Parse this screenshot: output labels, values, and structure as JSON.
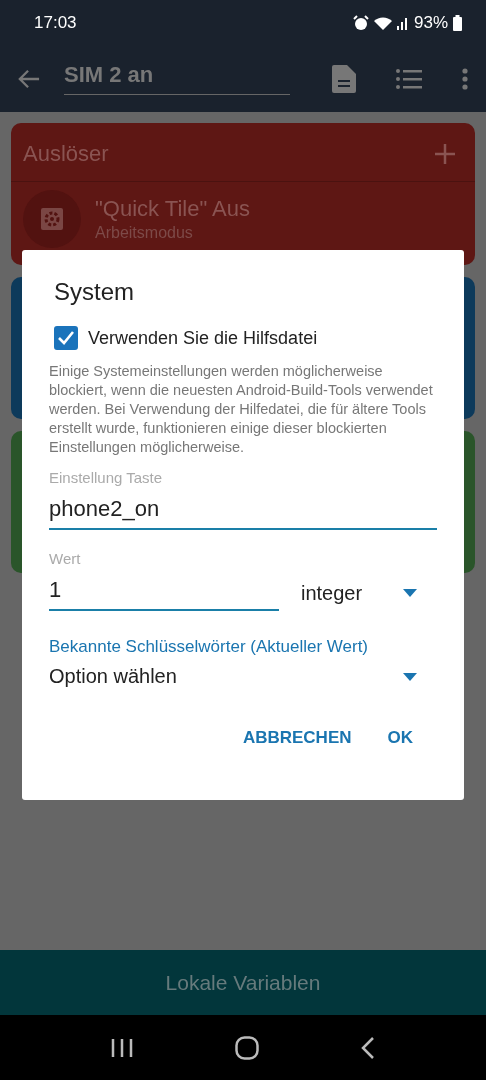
{
  "status_bar": {
    "time": "17:03",
    "battery": "93%"
  },
  "app_bar": {
    "title": "SIM 2 an"
  },
  "sections": [
    {
      "title": "Auslöser",
      "color": "#5e1714",
      "items": [
        {
          "title": "\"Quick Tile\" Aus",
          "subtitle": "Arbeitsmodus"
        }
      ]
    },
    {
      "color": "#0d3a5b"
    },
    {
      "color": "#2a552a"
    }
  ],
  "dialog": {
    "title": "System",
    "checkbox": {
      "label": "Verwenden Sie die Hilfsdatei",
      "checked": true
    },
    "description": "Einige Systemeinstellungen werden möglicherweise blockiert, wenn die neuesten Android-Build-Tools verwendet werden. Bei Verwendung der Hilfedatei, die für ältere Tools erstellt wurde, funktionieren einige dieser blockierten Einstellungen möglicherweise.",
    "key_field": {
      "label": "Einstellung Taste",
      "value": "phone2_on"
    },
    "value_field": {
      "label": "Wert",
      "value": "1"
    },
    "type_dropdown": {
      "value": "integer"
    },
    "keywords_link": "Bekannte Schlüsselwörter (Aktueller Wert)",
    "option_dropdown": {
      "value": "Option wählen"
    },
    "buttons": [
      "ABBRECHEN",
      "OK"
    ]
  },
  "bottom_bar": {
    "label": "Lokale Variablen"
  }
}
